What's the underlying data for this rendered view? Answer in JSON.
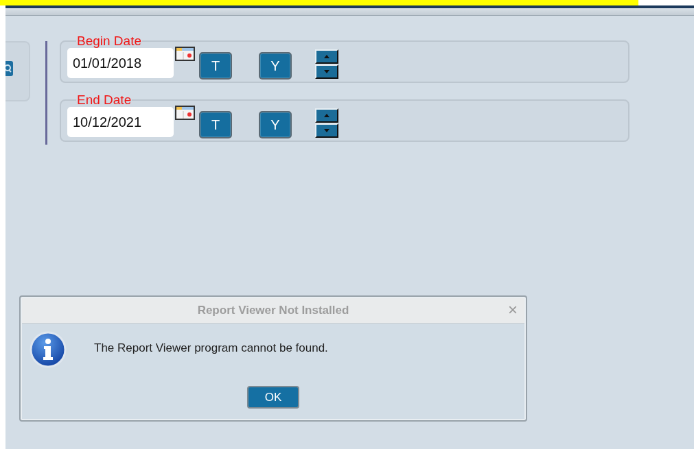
{
  "date_groups": [
    {
      "label": "Begin Date",
      "value": "01/01/2018",
      "buttons": [
        "T",
        "Y"
      ]
    },
    {
      "label": "End Date",
      "value": "10/12/2021",
      "buttons": [
        "T",
        "Y"
      ]
    }
  ],
  "dialog": {
    "title": "Report Viewer Not Installed",
    "close": "×",
    "message": "The Report Viewer program cannot be found.",
    "buttons": [
      "OK"
    ]
  }
}
